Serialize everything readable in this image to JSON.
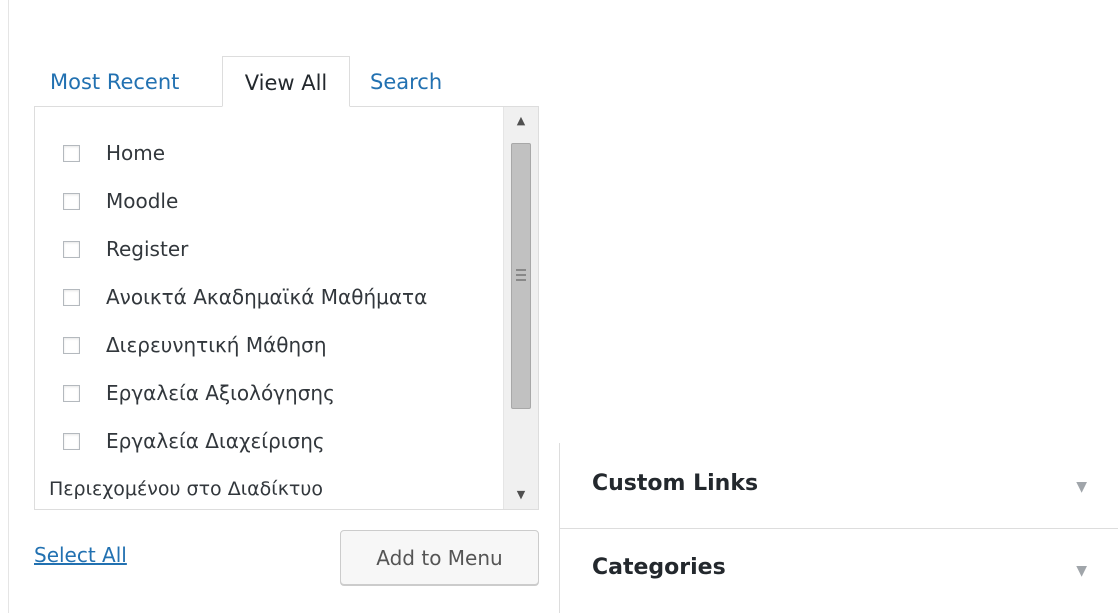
{
  "tabs": [
    {
      "label": "Most Recent",
      "active": false
    },
    {
      "label": "View All",
      "active": true
    },
    {
      "label": "Search",
      "active": false
    }
  ],
  "pages": [
    {
      "label": "Home",
      "checked": false
    },
    {
      "label": "Moodle",
      "checked": false
    },
    {
      "label": "Register",
      "checked": false
    },
    {
      "label": "Ανοικτά Ακαδημαϊκά Μαθήματα",
      "checked": false
    },
    {
      "label": "Διερευνητική Μάθηση",
      "checked": false
    },
    {
      "label": "Εργαλεία Αξιολόγησης",
      "checked": false
    },
    {
      "label": "Εργαλεία Διαχείρισης",
      "checked": false
    }
  ],
  "partial_item": "Περιεχομένου στο Διαδίκτυο",
  "actions": {
    "select_all": "Select All",
    "add_to_menu": "Add to Menu"
  },
  "accordion": [
    {
      "title": "Custom Links",
      "icon": "triangle-down-icon"
    },
    {
      "title": "Categories",
      "icon": "triangle-down-icon"
    }
  ],
  "colors": {
    "link": "#2271b1",
    "border": "#dddddd",
    "text": "#32373c"
  }
}
